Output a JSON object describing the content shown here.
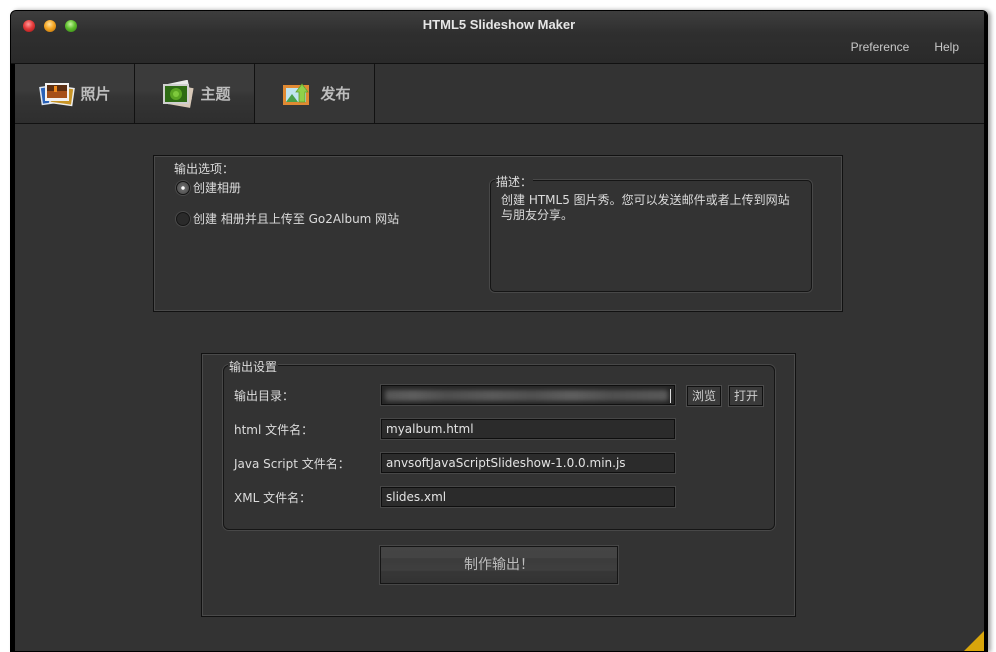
{
  "window": {
    "title": "HTML5 Slideshow Maker",
    "menu": [
      "Preference",
      "Help"
    ]
  },
  "tabs": [
    {
      "label": "照片",
      "icon": "photos-icon",
      "active": false
    },
    {
      "label": "主题",
      "icon": "theme-icon",
      "active": false
    },
    {
      "label": "发布",
      "icon": "publish-icon",
      "active": true
    }
  ],
  "output_options": {
    "title": "输出选项：",
    "options": [
      {
        "label": "创建相册",
        "checked": true
      },
      {
        "label": "创建 相册并且上传至 Go2Album 网站",
        "checked": false
      }
    ],
    "description": {
      "legend": "描述：",
      "text": "创建 HTML5 图片秀。您可以发送邮件或者上传到网站与朋友分享。"
    }
  },
  "output_settings": {
    "legend": "输出设置",
    "fields": [
      {
        "label": "输出目录：",
        "value": "",
        "blurred": true
      },
      {
        "label": "html 文件名：",
        "value": "myalbum.html"
      },
      {
        "label": "Java Script 文件名：",
        "value": "anvsoftJavaScriptSlideshow-1.0.0.min.js"
      },
      {
        "label": "XML 文件名：",
        "value": "slides.xml"
      }
    ],
    "browse_label": "浏览",
    "open_label": "打开",
    "make_output_label": "制作输出！"
  },
  "colors": {
    "background": "#333333",
    "accent_corner": "#d9a60b"
  }
}
